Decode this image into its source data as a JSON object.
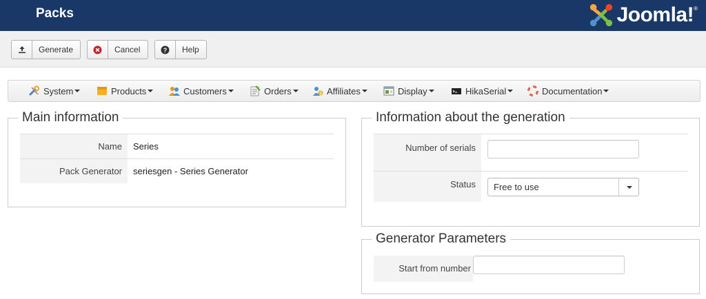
{
  "header": {
    "title": "Packs",
    "logo_text": "Joomla!"
  },
  "toolbar": {
    "generate": "Generate",
    "cancel": "Cancel",
    "help": "Help"
  },
  "menu": {
    "items": [
      {
        "label": "System",
        "icon": "wrench-icon"
      },
      {
        "label": "Products",
        "icon": "box-icon"
      },
      {
        "label": "Customers",
        "icon": "users-icon"
      },
      {
        "label": "Orders",
        "icon": "orders-icon"
      },
      {
        "label": "Affiliates",
        "icon": "affiliates-icon"
      },
      {
        "label": "Display",
        "icon": "display-icon"
      },
      {
        "label": "HikaSerial",
        "icon": "serial-icon"
      },
      {
        "label": "Documentation",
        "icon": "lifebuoy-icon"
      }
    ]
  },
  "main_info": {
    "legend": "Main information",
    "name_label": "Name",
    "name_value": "Series",
    "generator_label": "Pack Generator",
    "generator_value": "seriesgen - Series Generator"
  },
  "generation_info": {
    "legend": "Information about the generation",
    "serials_label": "Number of serials",
    "serials_value": "",
    "status_label": "Status",
    "status_value": "Free to use"
  },
  "generator_params": {
    "legend": "Generator Parameters",
    "start_label": "Start from number",
    "start_value": ""
  },
  "colors": {
    "header_bg": "#1a3867",
    "toolbar_bg": "#f0f0f0",
    "cancel_red": "#c0262c"
  }
}
